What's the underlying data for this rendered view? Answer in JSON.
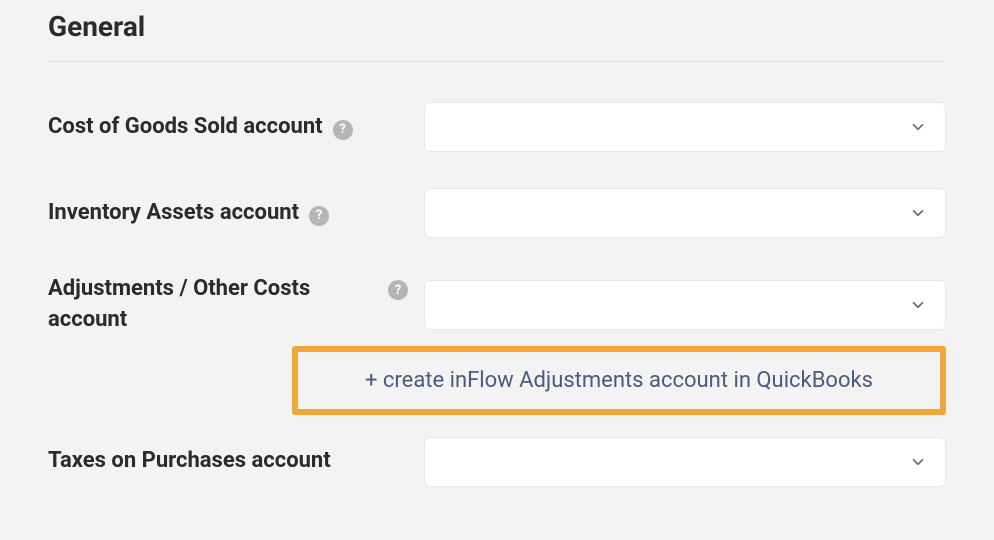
{
  "section": {
    "title": "General"
  },
  "fields": {
    "cogs": {
      "label": "Cost of Goods Sold account",
      "value": ""
    },
    "inventory": {
      "label": "Inventory Assets account",
      "value": ""
    },
    "adjustments": {
      "label": "Adjustments / Other Costs account",
      "value": ""
    },
    "taxes": {
      "label": "Taxes on Purchases account",
      "value": ""
    }
  },
  "callout": {
    "link_text": "+ create inFlow Adjustments account in QuickBooks"
  },
  "icons": {
    "help": "?"
  }
}
